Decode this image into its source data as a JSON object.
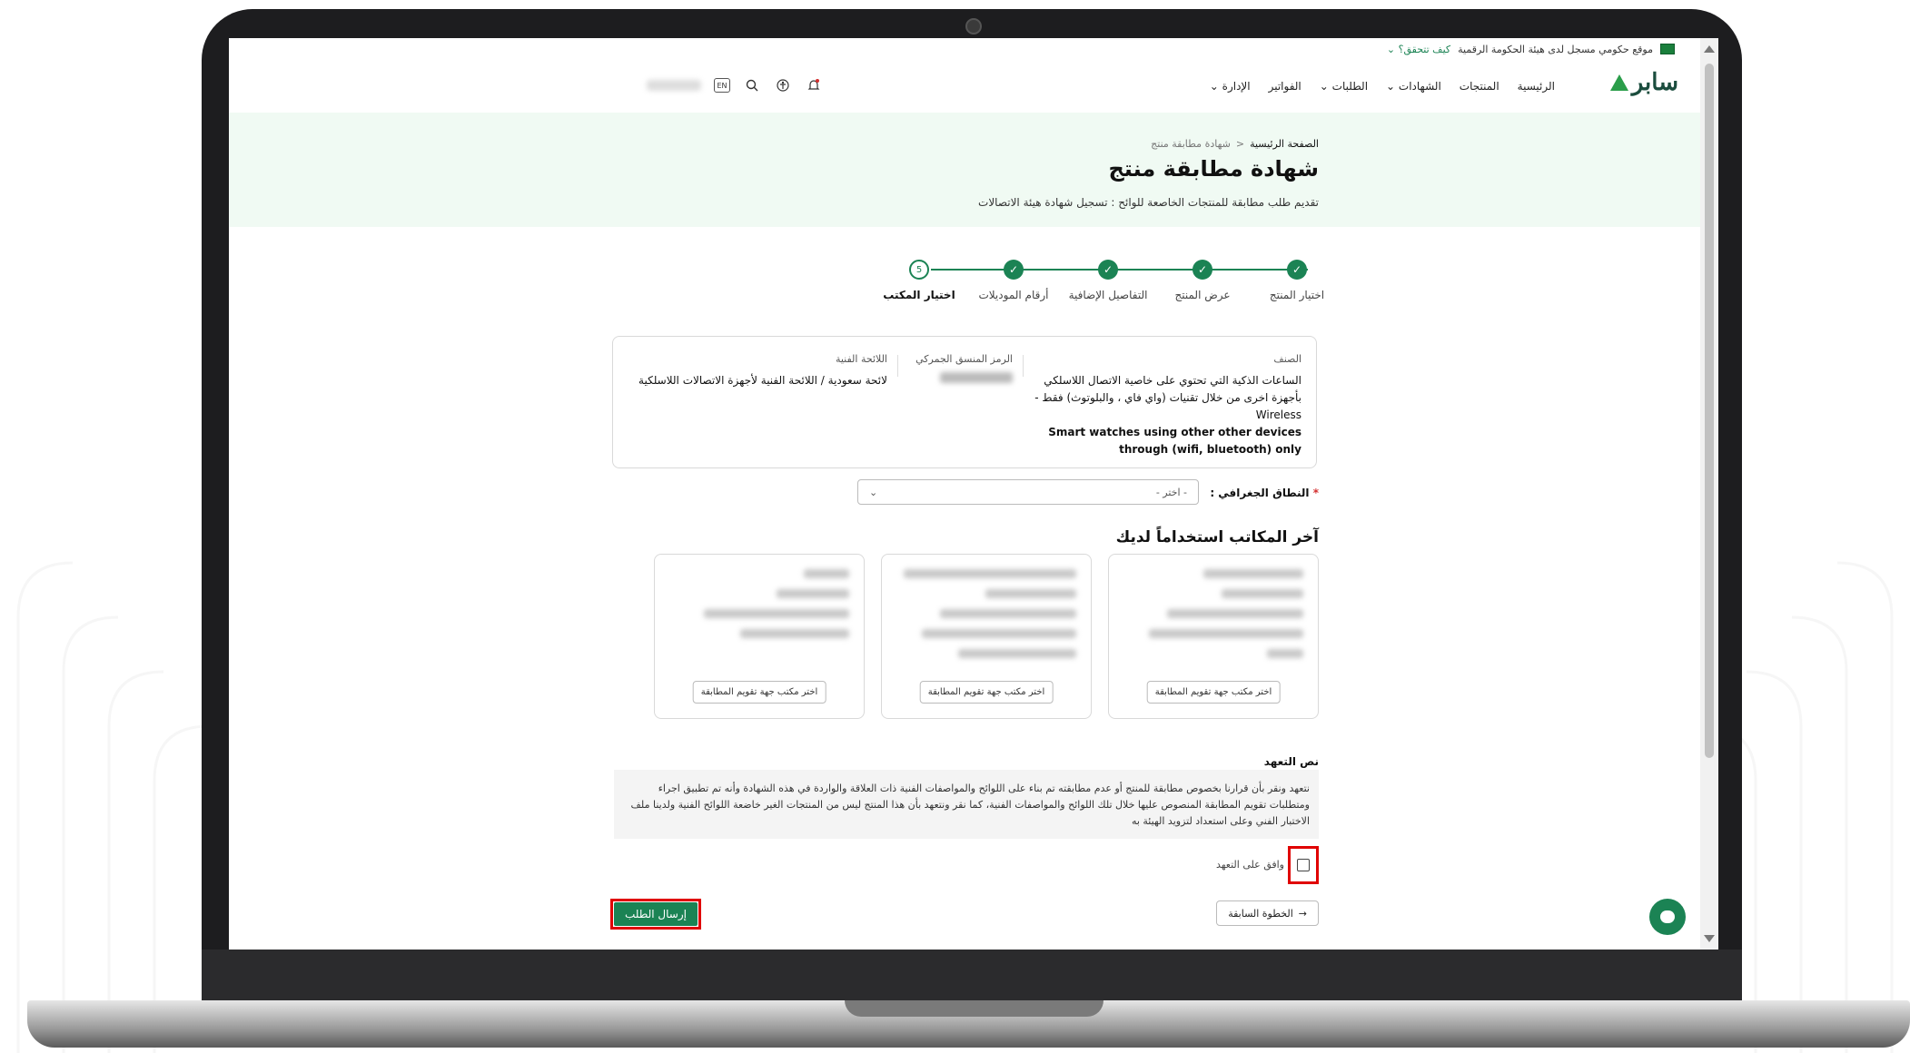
{
  "gov_banner": {
    "text": "موقع حكومي مسجل لدى هيئة الحكومة الرقمية",
    "link": "كيف تتحقق؟"
  },
  "header": {
    "logo_text": "سابر",
    "nav": [
      "الرئيسية",
      "المنتجات",
      "الشهادات",
      "الطلبات",
      "الفواتير",
      "الإدارة"
    ],
    "lang": "EN"
  },
  "hero": {
    "breadcrumb_home": "الصفحة الرئيسية",
    "breadcrumb_sep": "<",
    "breadcrumb_current": "شهادة مطابقة منتج",
    "title": "شهادة مطابقة منتج",
    "subtitle": "تقديم طلب مطابقة للمنتجات الخاصعة للوائح : تسجيل شهادة هيئة الاتصالات"
  },
  "stepper": {
    "steps": [
      {
        "label": "اختيار المنتج",
        "state": "done"
      },
      {
        "label": "عرض المنتج",
        "state": "done"
      },
      {
        "label": "التفاصيل الإضافية",
        "state": "done"
      },
      {
        "label": "أرقام الموديلات",
        "state": "done"
      },
      {
        "label": "اختيار المكتب",
        "state": "current",
        "number": "5"
      }
    ]
  },
  "product_info": {
    "category_label": "الصنف",
    "category_value_ar": "الساعات الذكية التي تحتوي على خاصية الاتصال اللاسلكي بأجهزة اخرى من خلال تقنيات (واي فاي ، والبلوتوث) فقط - Wireless",
    "category_value_en": "Smart watches using other other devices through (wifi, bluetooth) only",
    "hs_label": "الرمز المنسق الجمركي",
    "regulation_label": "اللائحة الفنية",
    "regulation_value": "لائحة سعودية / اللائحة الفنية لأجهزة الاتصالات اللاسلكية"
  },
  "geo": {
    "label": "النطاق الجغرافي :",
    "required_mark": "*",
    "select_placeholder": "- اختر -"
  },
  "offices": {
    "title": "آخر المكاتب استخداماً لديك",
    "button_label": "اختر مكتب جهة تقويم المطابقة"
  },
  "pledge": {
    "title": "نص التعهد",
    "text": "نتعهد ونقر بأن قرارنا بخصوص مطابقة للمنتج أو عدم مطابقته تم بناء على اللوائح والمواصفات الفنية ذات العلاقة والواردة في هذه الشهادة وأنه تم تطبيق اجراء ومتطلبات تقويم المطابقة المنصوص عليها خلال تلك اللوائح والمواصفات الفنية، كما نقر ونتعهد بأن هذا المنتج ليس من المنتجات الغير خاضعة اللوائح الفنية ولدينا ملف الاختبار الفني وعلى استعداد لتزويد الهيئة به",
    "agree_label": "وافق على التعهد"
  },
  "actions": {
    "back_label": "الخطوة السابقة",
    "submit_label": "إرسال الطلب"
  },
  "colors": {
    "primary": "#1b8354",
    "highlight": "#e00000",
    "hero_bg": "#f0faf3"
  }
}
